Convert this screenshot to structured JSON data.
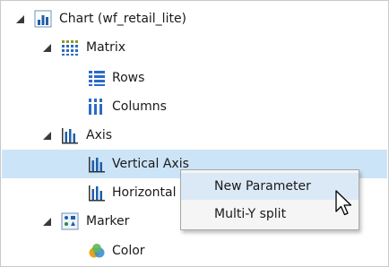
{
  "tree": {
    "root": {
      "label": "Chart (wf_retail_lite)",
      "icon": "chart-icon",
      "expanded": true
    },
    "matrix": {
      "label": "Matrix",
      "icon": "matrix-icon",
      "expanded": true,
      "children": [
        {
          "label": "Rows",
          "icon": "rows-icon"
        },
        {
          "label": "Columns",
          "icon": "columns-icon"
        }
      ]
    },
    "axis": {
      "label": "Axis",
      "icon": "axis-icon",
      "expanded": true,
      "children": [
        {
          "label": "Vertical Axis",
          "icon": "vertical-axis-icon",
          "selected": true
        },
        {
          "label": "Horizontal Axis",
          "icon": "horizontal-axis-icon"
        }
      ]
    },
    "marker": {
      "label": "Marker",
      "icon": "marker-icon",
      "expanded": true,
      "children": [
        {
          "label": "Color",
          "icon": "color-icon"
        }
      ]
    }
  },
  "context_menu": {
    "items": [
      {
        "label": "New Parameter",
        "hovered": true
      },
      {
        "label": "Multi-Y split",
        "hovered": false
      }
    ]
  },
  "colors": {
    "selection": "#cce4f7",
    "menu_hover": "#dbe9f7",
    "icon_blue": "#1f5fa8"
  }
}
